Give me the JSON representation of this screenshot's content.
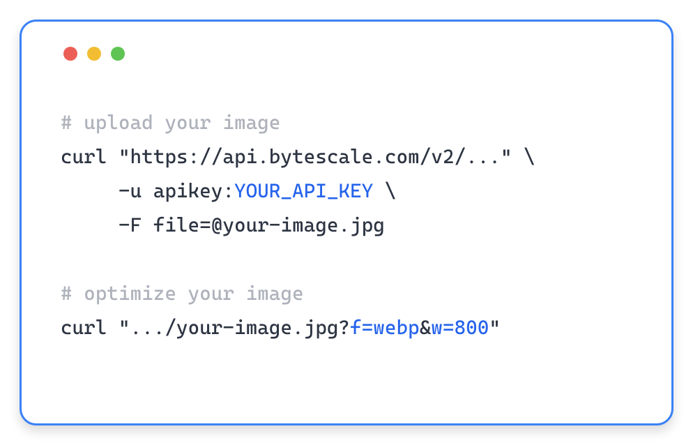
{
  "code": {
    "comment1": "# upload your image",
    "line2_prefix": "curl \"https://api.bytescale.com/v2/...\" \\",
    "line3_prefix": "     -u apikey:",
    "line3_highlight": "YOUR_API_KEY",
    "line3_suffix": " \\",
    "line4": "     -F file=@your-image.jpg",
    "comment2": "# optimize your image",
    "line6_prefix": "curl \".../your-image.jpg?",
    "line6_hl1": "f=webp",
    "line6_mid": "&",
    "line6_hl2": "w=800",
    "line6_suffix": "\""
  }
}
